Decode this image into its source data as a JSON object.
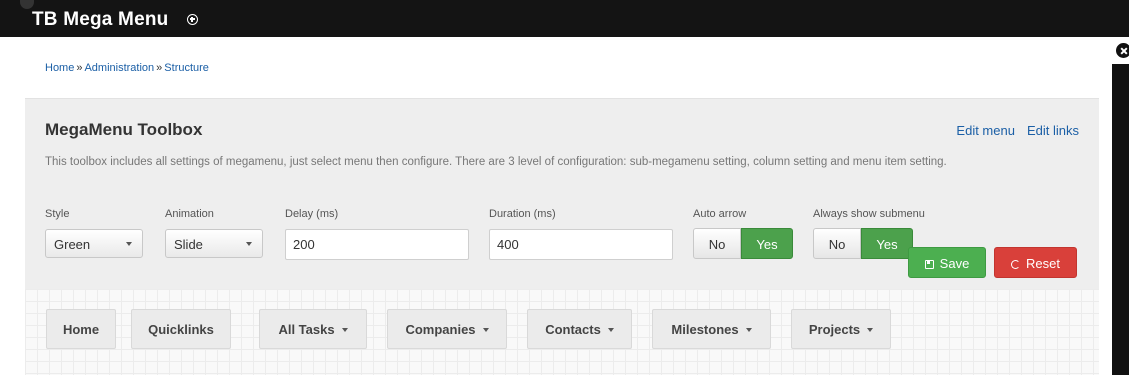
{
  "app": {
    "title": "TB Mega Menu"
  },
  "breadcrumb": [
    "Home",
    "Administration",
    "Structure"
  ],
  "toolbox": {
    "title": "MegaMenu Toolbox",
    "edit_menu": "Edit menu",
    "edit_links": "Edit links",
    "description": "This toolbox includes all settings of megamenu, just select menu then configure. There are 3 level of configuration: sub-megamenu setting, column setting and menu item setting.",
    "fields": {
      "style": {
        "label": "Style",
        "value": "Green"
      },
      "animation": {
        "label": "Animation",
        "value": "Slide"
      },
      "delay": {
        "label": "Delay (ms)",
        "value": "200"
      },
      "duration": {
        "label": "Duration (ms)",
        "value": "400"
      },
      "auto_arrow": {
        "label": "Auto arrow",
        "no": "No",
        "yes": "Yes",
        "selected": "Yes"
      },
      "always_show_submenu": {
        "label": "Always show submenu",
        "no": "No",
        "yes": "Yes",
        "selected": "Yes"
      }
    },
    "save_label": "Save",
    "reset_label": "Reset"
  },
  "menu_items": [
    {
      "label": "Home",
      "has_caret": false
    },
    {
      "label": "Quicklinks",
      "has_caret": false
    },
    {
      "label": "All Tasks",
      "has_caret": true
    },
    {
      "label": "Companies",
      "has_caret": true
    },
    {
      "label": "Contacts",
      "has_caret": true
    },
    {
      "label": "Milestones",
      "has_caret": true
    },
    {
      "label": "Projects",
      "has_caret": true
    }
  ],
  "colors": {
    "link": "#1b5fa6",
    "yes_active": "#4ca14c",
    "save": "#4caf50",
    "reset": "#d9403a"
  }
}
